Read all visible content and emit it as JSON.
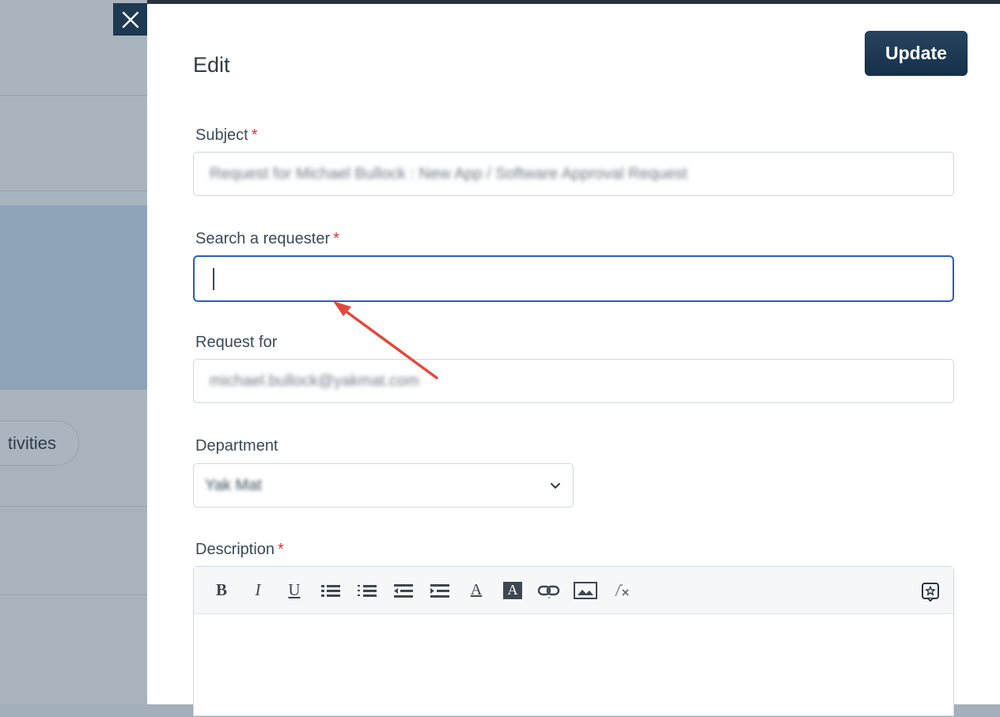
{
  "background": {
    "activities_pill": "tivities"
  },
  "drawer": {
    "title": "Edit",
    "update_label": "Update",
    "subject": {
      "label": "Subject",
      "required": "*",
      "value": "Request for Michael Bullock : New App / Software Approval Request"
    },
    "requester": {
      "label": "Search a requester",
      "required": "*",
      "value": ""
    },
    "request_for": {
      "label": "Request for",
      "value": "michael.bullock@yakmat.com"
    },
    "department": {
      "label": "Department",
      "value": "Yak Mat"
    },
    "description": {
      "label": "Description",
      "required": "*",
      "toolbar": [
        "bold",
        "italic",
        "underline",
        "bulleted-list",
        "numbered-list",
        "outdent",
        "indent",
        "font-color",
        "background-color",
        "link",
        "image",
        "clear-format"
      ],
      "toolbar_glyphs": {
        "bold": "B",
        "italic": "I",
        "underline": "U",
        "font_color": "A",
        "background_color": "A"
      }
    }
  },
  "colors": {
    "primary": "#1e3a53",
    "focus": "#2c5cc5",
    "required": "#d9342b",
    "annotation_arrow": "#e2493a"
  }
}
